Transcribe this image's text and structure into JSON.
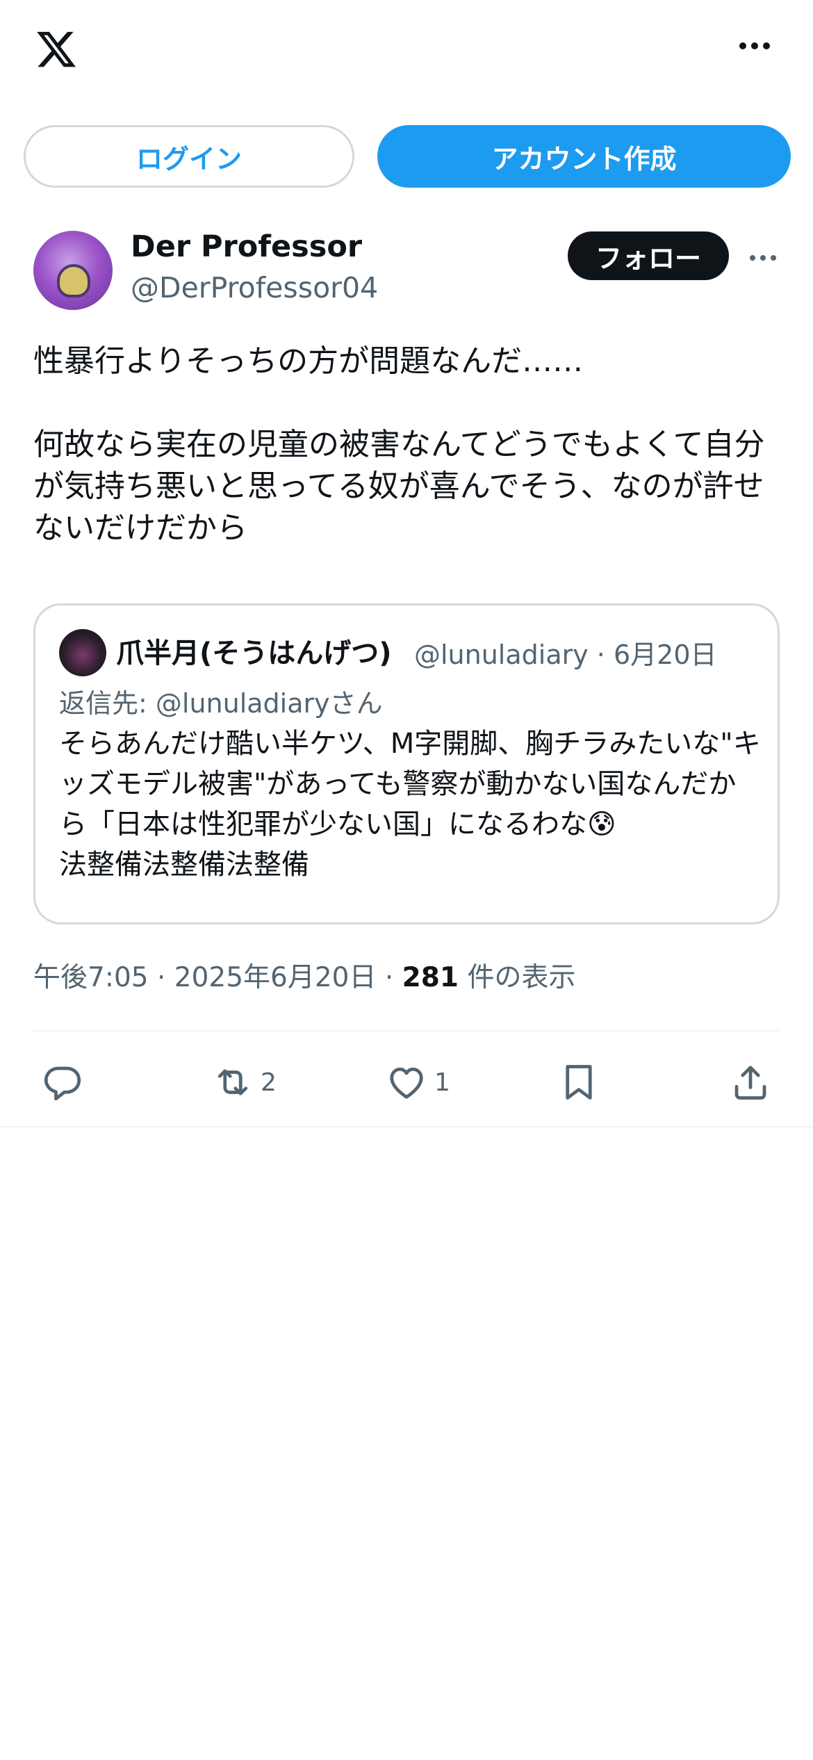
{
  "header": {
    "logo_icon": "x-logo-icon",
    "more_icon": "more-horizontal-icon"
  },
  "auth": {
    "login_label": "ログイン",
    "signup_label": "アカウント作成"
  },
  "tweet": {
    "author_name": "Der Professor",
    "author_handle": "@DerProfessor04",
    "follow_label": "フォロー",
    "text": "性暴行よりそっちの方が問題なんだ……\n\n何故なら実在の児童の被害なんてどうでもよくて自分が気持ち悪いと思ってる奴が喜んでそう、なのが許せないだけだから",
    "quote": {
      "author_name": "爪半月(そうはんげつ)",
      "meta": "@lunuladiary · 6月20日",
      "reply_to": "返信先: @lunuladiaryさん",
      "text": "そらあんだけ酷い半ケツ、M字開脚、胸チラみたいな\"キッズモデル被害\"があっても警察が動かない国なんだから「日本は性犯罪が少ない国」になるわな😰\n法整備法整備法整備"
    },
    "time": "午後7:05 · 2025年6月20日 · ",
    "views_count": "281",
    "views_label": " 件の表示",
    "actions": {
      "retweet_count": "2",
      "like_count": "1"
    }
  },
  "colors": {
    "accent": "#1d9bf0",
    "text_primary": "#0f1419",
    "text_secondary": "#536471",
    "border": "#cfd9de"
  }
}
